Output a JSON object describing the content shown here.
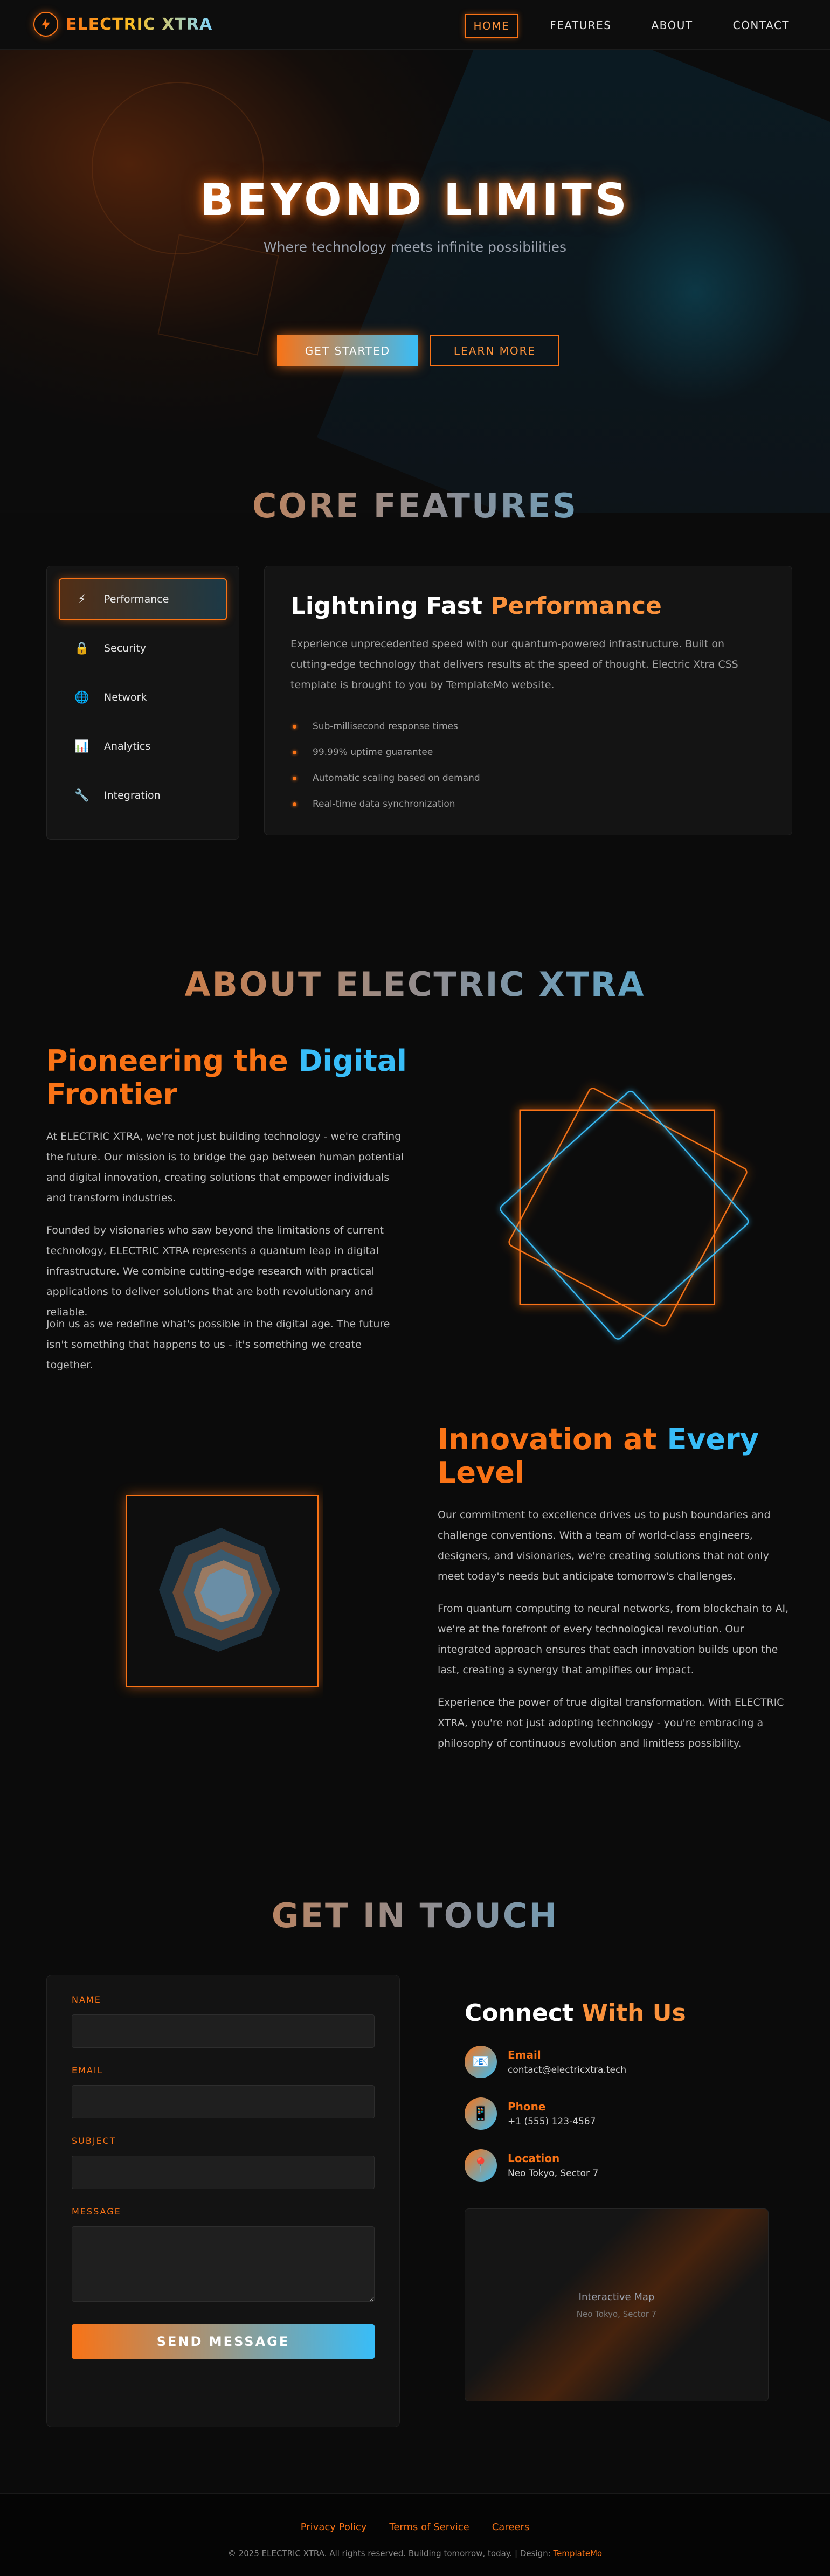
{
  "nav": {
    "logo_text": "ELECTRIC XTRA",
    "items": [
      "HOME",
      "FEATURES",
      "ABOUT",
      "CONTACT"
    ],
    "active": "HOME"
  },
  "hero": {
    "title": "BEYOND LIMITS",
    "subtitle": "Where technology meets infinite possibilities",
    "primary_button": "GET STARTED",
    "secondary_button": "LEARN MORE"
  },
  "features": {
    "section_title": "CORE FEATURES",
    "tabs": [
      {
        "label": "Performance",
        "icon": "⚡"
      },
      {
        "label": "Security",
        "icon": "🔒"
      },
      {
        "label": "Network",
        "icon": "🌐"
      },
      {
        "label": "Analytics",
        "icon": "📊"
      },
      {
        "label": "Integration",
        "icon": "🔧"
      }
    ],
    "active_tab": "Performance",
    "panel": {
      "title_main": "Lightning Fast ",
      "title_accent": "Performance",
      "description": "Experience unprecedented speed with our quantum-powered infrastructure. Built on cutting-edge technology that delivers results at the speed of thought. Electric Xtra CSS template is brought to you by TemplateMo website.",
      "bullets": [
        "Sub-millisecond response times",
        "99.99% uptime guarantee",
        "Automatic scaling based on demand",
        "Real-time data synchronization"
      ]
    }
  },
  "about": {
    "section_title": "ABOUT ELECTRIC XTRA",
    "block1": {
      "heading_a": "Pioneering the ",
      "heading_b": "Digital",
      "heading_c": "Frontier",
      "paragraphs": [
        "At ELECTRIC XTRA, we're not just building technology - we're crafting the future. Our mission is to bridge the gap between human potential and digital innovation, creating solutions that empower individuals and transform industries.",
        "Founded by visionaries who saw beyond the limitations of current technology, ELECTRIC XTRA represents a quantum leap in digital infrastructure. We combine cutting-edge research with practical applications to deliver solutions that are both revolutionary and reliable.",
        "Join us as we redefine what's possible in the digital age. The future isn't something that happens to us - it's something we create together."
      ]
    },
    "block2": {
      "heading_a": "Innovation at ",
      "heading_b": "Every",
      "heading_c": "Level",
      "paragraphs": [
        "Our commitment to excellence drives us to push boundaries and challenge conventions. With a team of world-class engineers, designers, and visionaries, we're creating solutions that not only meet today's needs but anticipate tomorrow's challenges.",
        "From quantum computing to neural networks, from blockchain to AI, we're at the forefront of every technological revolution. Our integrated approach ensures that each innovation builds upon the last, creating a synergy that amplifies our impact.",
        "Experience the power of true digital transformation. With ELECTRIC XTRA, you're not just adopting technology - you're embracing a philosophy of continuous evolution and limitless possibility."
      ]
    }
  },
  "contact": {
    "section_title": "GET IN TOUCH",
    "form": {
      "name_label": "NAME",
      "email_label": "EMAIL",
      "subject_label": "SUBJECT",
      "message_label": "MESSAGE",
      "submit": "SEND MESSAGE"
    },
    "connect_title_main": "Connect ",
    "connect_title_accent": "With Us",
    "items": [
      {
        "label": "Email",
        "value": "contact@electricxtra.tech",
        "icon": "📧"
      },
      {
        "label": "Phone",
        "value": "+1 (555) 123-4567",
        "icon": "📱"
      },
      {
        "label": "Location",
        "value": "Neo Tokyo, Sector 7",
        "icon": "📍"
      }
    ],
    "map": {
      "title": "Interactive Map",
      "subtitle": "Neo Tokyo, Sector 7"
    }
  },
  "footer": {
    "links": [
      "Privacy Policy",
      "Terms of Service",
      "Careers"
    ],
    "copyright": "© 2025 ELECTRIC XTRA. All rights reserved. Building tomorrow, today. | Design: ",
    "credit": "TemplateMo"
  },
  "colors": {
    "accent_orange": "#f97316",
    "accent_blue": "#38bdf8",
    "background": "#0b0b0b"
  }
}
